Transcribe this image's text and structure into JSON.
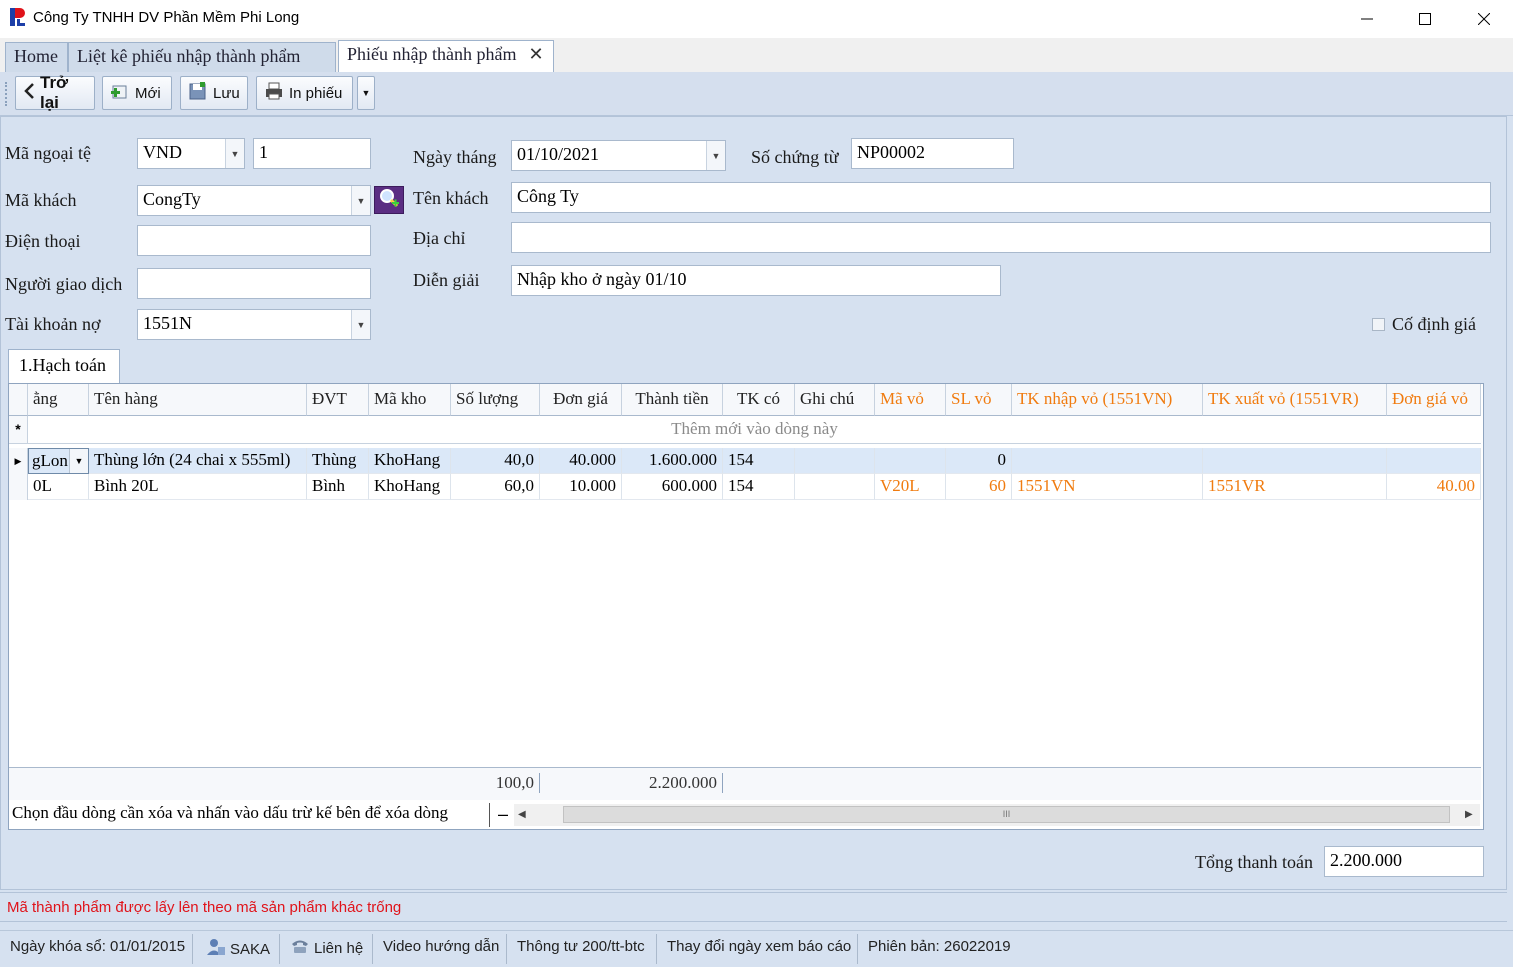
{
  "window": {
    "title": "Công Ty TNHH DV Phần Mềm Phi Long"
  },
  "tabs": [
    {
      "label": "Home"
    },
    {
      "label": "Liệt kê phiếu nhập thành phẩm"
    },
    {
      "label": "Phiếu nhập thành phẩm",
      "active": true
    }
  ],
  "toolbar": {
    "back": "Trở lại",
    "new": "Mới",
    "save": "Lưu",
    "print": "In phiếu"
  },
  "form": {
    "ma_ngoai_te_label": "Mã ngoại tệ",
    "ma_ngoai_te": "VND",
    "ty_gia": "1",
    "ngay_thang_label": "Ngày tháng",
    "ngay_thang": "01/10/2021",
    "so_chung_tu_label": "Số chứng từ",
    "so_chung_tu": "NP00002",
    "ma_khach_label": "Mã khách",
    "ma_khach": "CongTy",
    "ten_khach_label": "Tên khách",
    "ten_khach": "Công Ty",
    "dien_thoai_label": "Điện thoại",
    "dien_thoai": "",
    "dia_chi_label": "Địa chỉ",
    "dia_chi": "",
    "nguoi_giao_dich_label": "Người giao dịch",
    "nguoi_giao_dich": "",
    "dien_giai_label": "Diễn giải",
    "dien_giai": "Nhập kho ở ngày 01/10",
    "tai_khoan_no_label": "Tài khoản nợ",
    "tai_khoan_no": "1551N",
    "co_dinh_gia_label": "Cố định giá"
  },
  "subtab": {
    "label": "1.Hạch toán"
  },
  "grid": {
    "columns": [
      "ằng",
      "Tên hàng",
      "ĐVT",
      "Mã kho",
      "Số lượng",
      "Đơn giá",
      "Thành tiền",
      "TK có",
      "Ghi chú",
      "Mã vỏ",
      "SL vỏ",
      "TK nhập vỏ (1551VN)",
      "TK xuất vỏ (1551VR)",
      "Đơn giá vỏ"
    ],
    "new_row_text": "Thêm mới vào dòng này",
    "rows": [
      [
        "gLon",
        "Thùng lớn (24 chai x 555ml)",
        "Thùng",
        "KhoHang",
        "40,0",
        "40.000",
        "1.600.000",
        "154",
        "",
        "",
        "0",
        "",
        "",
        ""
      ],
      [
        "0L",
        "Bình 20L",
        "Bình",
        "KhoHang",
        "60,0",
        "10.000",
        "600.000",
        "154",
        "",
        "V20L",
        "60",
        "1551VN",
        "1551VR",
        "40.00"
      ]
    ],
    "total_qty": "100,0",
    "total_amount": "2.200.000",
    "hint": "Chọn đầu dòng cần xóa và nhấn vào dấu trừ kế bên để xóa dòng",
    "scroll_grip": "III"
  },
  "tong_thanh_toan_label": "Tổng thanh toán",
  "tong_thanh_toan": "2.200.000",
  "message": "Mã thành phẩm được lấy lên theo mã sản phẩm khác trống",
  "statusbar": {
    "ngay_khoa_so": "Ngày khóa sổ: 01/01/2015",
    "user": "SAKA",
    "lien_he": "Liên hệ",
    "video": "Video hướng dẫn",
    "thong_tu": "Thông tư 200/tt-btc",
    "thay_doi": "Thay đổi ngày xem báo cáo",
    "phien_ban": "Phiên bản: 26022019"
  },
  "colors": {
    "orange": "#f07b0f",
    "message_red": "#e0131a",
    "logo_blue": "#1d3fa8"
  }
}
